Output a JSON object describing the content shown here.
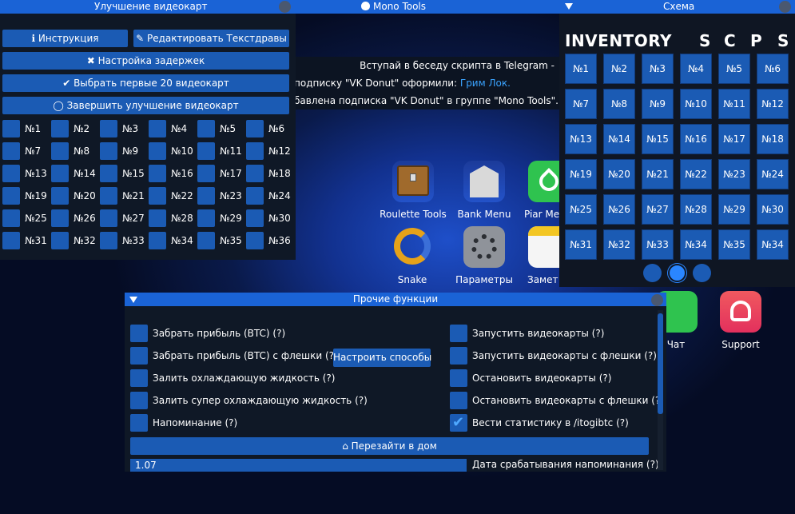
{
  "topbar": {
    "left_title": "Улучшение видеокарт",
    "center_title": "Mono Tools",
    "right_title": "Схема"
  },
  "notifications": [
    "Вступай в беседу скрипта в Telegram - ",
    "подписку \"VK Donut\" оформили: ",
    "Грим Лок.",
    "бавлена подписка \"VK Donut\" в группе \"Mono Tools\". За п"
  ],
  "apps": {
    "roulette": "Roulette Tools",
    "bank": "Bank Menu",
    "piar": "Piar Me",
    "snake": "Snake",
    "params": "Параметры",
    "notes": "Замет",
    "chat": "Чат",
    "support": "Support"
  },
  "gpu_window": {
    "buttons": {
      "instruction": "Инструкция",
      "edit": "Редактировать Текстдравы",
      "delays": "Настройка задержек",
      "select20": "Выбрать первые 20 видеокарт",
      "finish": "Завершить улучшение видеокарт"
    },
    "cards": [
      "№1",
      "№2",
      "№3",
      "№4",
      "№5",
      "№6",
      "№7",
      "№8",
      "№9",
      "№10",
      "№11",
      "№12",
      "№13",
      "№14",
      "№15",
      "№16",
      "№17",
      "№18",
      "№19",
      "№20",
      "№21",
      "№22",
      "№23",
      "№24",
      "№25",
      "№26",
      "№27",
      "№28",
      "№29",
      "№30",
      "№31",
      "№32",
      "№33",
      "№34",
      "№35",
      "№36"
    ]
  },
  "scheme_window": {
    "inventory": "INVENTORY",
    "letters": [
      "S",
      "C",
      "P",
      "S"
    ],
    "cells": [
      "№1",
      "№2",
      "№3",
      "№4",
      "№5",
      "№6",
      "№7",
      "№8",
      "№9",
      "№10",
      "№11",
      "№12",
      "№13",
      "№14",
      "№15",
      "№16",
      "№17",
      "№18",
      "№19",
      "№20",
      "№21",
      "№22",
      "№23",
      "№24",
      "№25",
      "№26",
      "№27",
      "№28",
      "№29",
      "№30",
      "№31",
      "№32",
      "№33",
      "№34",
      "№35",
      "№34"
    ],
    "active_page": 2
  },
  "other_window": {
    "title": "Прочие функции",
    "left": [
      {
        "label": "Забрать прибыль (BTC)  (?)",
        "checked": false
      },
      {
        "label": "Забрать прибыль (BTC) с флешки  (?)",
        "checked": false
      },
      {
        "label": "Залить охлаждающую жидкость  (?)",
        "checked": false
      },
      {
        "label": "Залить супер охлаждающую жидкость  (?)",
        "checked": false
      },
      {
        "label": "Напоминание  (?)",
        "checked": false
      }
    ],
    "right": [
      {
        "label": "Запустить видеокарты  (?)",
        "checked": false
      },
      {
        "label": "Запустить видеокарты с флешки  (?)",
        "checked": false
      },
      {
        "label": "Остановить видеокарты  (?)",
        "checked": false
      },
      {
        "label": "Остановить видеокарты с флешки  (?)",
        "checked": false
      },
      {
        "label": "Вести статистику в /itogibtc  (?)",
        "checked": true
      }
    ],
    "configure_btn": "Настроить способы",
    "rejoin_btn": "Перезайти в дом",
    "input_value": "1.07",
    "bottom_label": "Дата срабатывания напоминания  (?)"
  },
  "colors": {
    "accent": "#1a63d6",
    "button": "#1b5bb4",
    "panel": "#0f1826"
  }
}
